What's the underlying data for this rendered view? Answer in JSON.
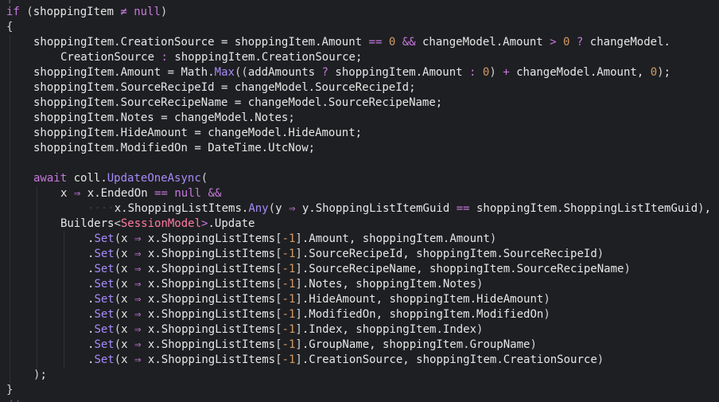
{
  "colors": {
    "background": "#1e1f22",
    "text": "#e6e6e6",
    "keyword": "#c678dd",
    "number": "#d19a66",
    "method": "#a78bfa",
    "type": "#ff7aa0"
  },
  "code": {
    "lines": [
      {
        "top": "if (shoppingItem ≠ null)"
      },
      {
        "text": "{"
      },
      {
        "text": "shoppingItem.CreationSource = shoppingItem.Amount == 0 && changeModel.Amount > 0 ? changeModel."
      },
      {
        "text": "CreationSource : shoppingItem.CreationSource;"
      },
      {
        "text": "shoppingItem.Amount = Math.Max((addAmounts ? shoppingItem.Amount : 0) + changeModel.Amount, 0);"
      },
      {
        "text": "shoppingItem.SourceRecipeId = changeModel.SourceRecipeId;"
      },
      {
        "text": "shoppingItem.SourceRecipeName = changeModel.SourceRecipeName;"
      },
      {
        "text": "shoppingItem.Notes = changeModel.Notes;"
      },
      {
        "text": "shoppingItem.HideAmount = changeModel.HideAmount;"
      },
      {
        "text": "shoppingItem.ModifiedOn = DateTime.UtcNow;"
      },
      {
        "text": ""
      },
      {
        "text": "await coll.UpdateOneAsync("
      },
      {
        "text": "x ⇒ x.EndedOn == null &&"
      },
      {
        "text": "x.ShoppingListItems.Any(y ⇒ y.ShoppingListItemGuid == shoppingItem.ShoppingListItemGuid),"
      },
      {
        "text": "Builders<SessionModel>.Update"
      },
      {
        "text": ".Set(x ⇒ x.ShoppingListItems[-1].Amount, shoppingItem.Amount)"
      },
      {
        "text": ".Set(x ⇒ x.ShoppingListItems[-1].SourceRecipeId, shoppingItem.SourceRecipeId)"
      },
      {
        "text": ".Set(x ⇒ x.ShoppingListItems[-1].SourceRecipeName, shoppingItem.SourceRecipeName)"
      },
      {
        "text": ".Set(x ⇒ x.ShoppingListItems[-1].Notes, shoppingItem.Notes)"
      },
      {
        "text": ".Set(x ⇒ x.ShoppingListItems[-1].HideAmount, shoppingItem.HideAmount)"
      },
      {
        "text": ".Set(x ⇒ x.ShoppingListItems[-1].ModifiedOn, shoppingItem.ModifiedOn)"
      },
      {
        "text": ".Set(x ⇒ x.ShoppingListItems[-1].Index, shoppingItem.Index)"
      },
      {
        "text": ".Set(x ⇒ x.ShoppingListItems[-1].GroupName, shoppingItem.GroupName)"
      },
      {
        "text": ".Set(x ⇒ x.ShoppingListItems[-1].CreationSource, shoppingItem.CreationSource)"
      },
      {
        "text": ");"
      },
      {
        "text": "}"
      }
    ]
  }
}
